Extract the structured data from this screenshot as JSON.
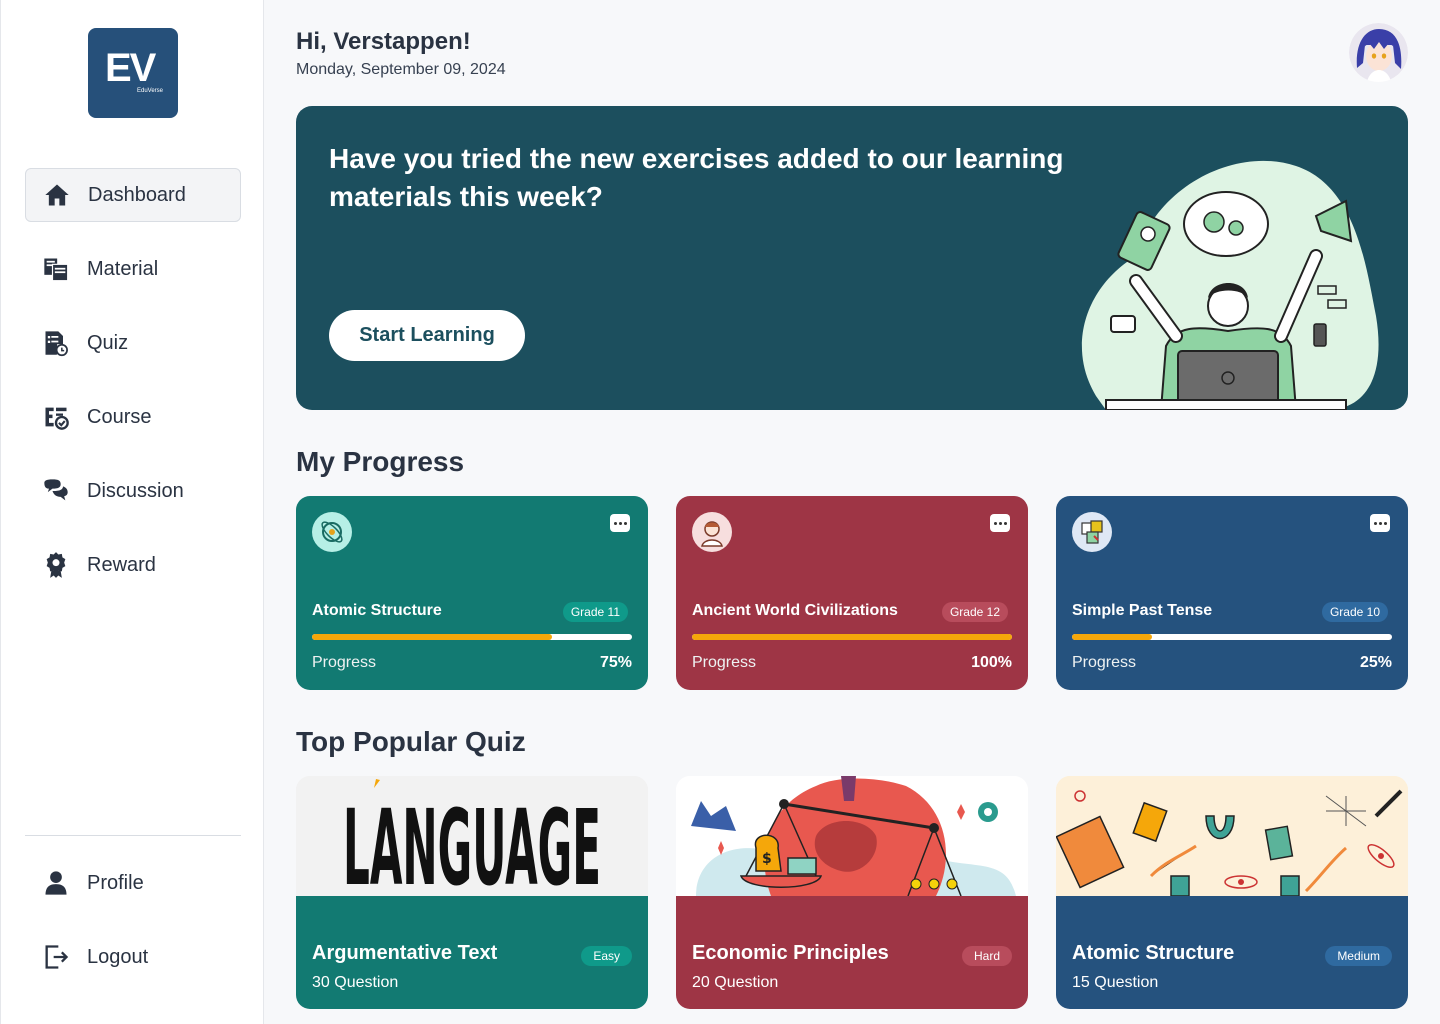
{
  "brand": {
    "logo_big": "EV",
    "logo_small": "EduVerse"
  },
  "sidebar": {
    "items": [
      {
        "label": "Dashboard",
        "icon": "home-icon"
      },
      {
        "label": "Material",
        "icon": "material-icon"
      },
      {
        "label": "Quiz",
        "icon": "quiz-icon"
      },
      {
        "label": "Course",
        "icon": "course-icon"
      },
      {
        "label": "Discussion",
        "icon": "discussion-icon"
      },
      {
        "label": "Reward",
        "icon": "reward-icon"
      }
    ],
    "bottom": [
      {
        "label": "Profile",
        "icon": "user-icon"
      },
      {
        "label": "Logout",
        "icon": "logout-icon"
      }
    ]
  },
  "header": {
    "greeting": "Hi, Verstappen!",
    "date": "Monday, September 09, 2024"
  },
  "hero": {
    "text": "Have you tried the new exercises added to our learning materials this week?",
    "button": "Start Learning"
  },
  "progress": {
    "title": "My Progress",
    "label": "Progress",
    "cards": [
      {
        "title": "Atomic Structure",
        "grade": "Grade 11",
        "percent": "75%",
        "fraction": 0.75,
        "color": "#127a72"
      },
      {
        "title": "Ancient World Civilizations",
        "grade": "Grade 12",
        "percent": "100%",
        "fraction": 1.0,
        "color": "#9e3545"
      },
      {
        "title": "Simple Past Tense",
        "grade": "Grade 10",
        "percent": "25%",
        "fraction": 0.25,
        "color": "#25527e"
      }
    ]
  },
  "quiz": {
    "title": "Top Popular Quiz",
    "cards": [
      {
        "title": "Argumentative Text",
        "count": "30 Question",
        "difficulty": "Easy",
        "image_text": "LANGUAGE",
        "color": "#127a72"
      },
      {
        "title": "Economic Principles",
        "count": "20 Question",
        "difficulty": "Hard",
        "color": "#9e3545"
      },
      {
        "title": "Atomic Structure",
        "count": "15 Question",
        "difficulty": "Medium",
        "color": "#25527e"
      }
    ]
  }
}
